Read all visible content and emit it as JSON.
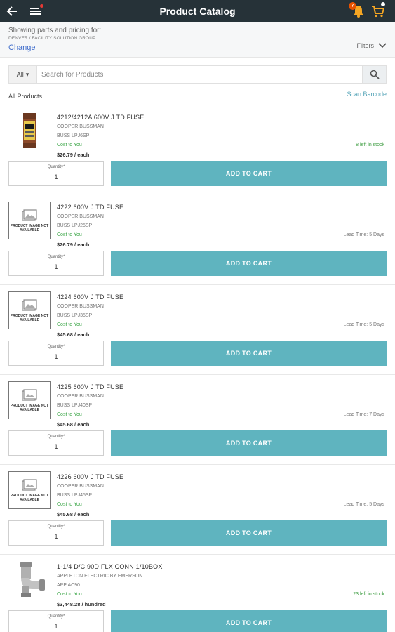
{
  "header": {
    "title": "Product Catalog",
    "notification_count": "7"
  },
  "location": {
    "line1": "Showing parts and pricing for:",
    "line2": "DENVER / FACILITY SOLUTION GROUP",
    "change_label": "Change",
    "filters_label": "Filters"
  },
  "search": {
    "category": "All",
    "placeholder": "Search for Products"
  },
  "list": {
    "heading": "All Products",
    "scan_label": "Scan Barcode"
  },
  "not_available_text": "PRODUCT IMAGE NOT AVAILABLE",
  "products": [
    {
      "name": "4212/4212A 600V J TD FUSE",
      "manufacturer": "COOPER BUSSMAN",
      "part": "BUSS LPJ6SP",
      "cost_label": "Cost to You",
      "price": "$26.79 / each",
      "availability": "8 left in stock",
      "qty_label": "Quantity*",
      "qty": "1",
      "button": "ADD TO CART"
    },
    {
      "name": "4222 600V J TD FUSE",
      "manufacturer": "COOPER BUSSMAN",
      "part": "BUSS LPJ25SP",
      "cost_label": "Cost to You",
      "price": "$26.79 / each",
      "availability": "Lead Time: 5 Days",
      "qty_label": "Quantity*",
      "qty": "1",
      "button": "ADD TO CART"
    },
    {
      "name": "4224 600V J TD FUSE",
      "manufacturer": "COOPER BUSSMAN",
      "part": "BUSS LPJ35SP",
      "cost_label": "Cost to You",
      "price": "$45.68 / each",
      "availability": "Lead Time: 5 Days",
      "qty_label": "Quantity*",
      "qty": "1",
      "button": "ADD TO CART"
    },
    {
      "name": "4225 600V J TD FUSE",
      "manufacturer": "COOPER BUSSMAN",
      "part": "BUSS LPJ40SP",
      "cost_label": "Cost to You",
      "price": "$45.68 / each",
      "availability": "Lead Time: 7 Days",
      "qty_label": "Quantity*",
      "qty": "1",
      "button": "ADD TO CART"
    },
    {
      "name": "4226 600V J TD FUSE",
      "manufacturer": "COOPER BUSSMAN",
      "part": "BUSS LPJ45SP",
      "cost_label": "Cost to You",
      "price": "$45.68 / each",
      "availability": "Lead Time: 5 Days",
      "qty_label": "Quantity*",
      "qty": "1",
      "button": "ADD TO CART"
    },
    {
      "name": "1-1/4 D/C 90D FLX CONN 1/10BOX",
      "manufacturer": "APPLETON ELECTRIC BY EMERSON",
      "part": "APP AC90",
      "cost_label": "Cost to You",
      "price": "$3,448.28 / hundred",
      "availability": "23 left in stock",
      "qty_label": "Quantity*",
      "qty": "1",
      "button": "ADD TO CART"
    }
  ],
  "colors": {
    "topbar": "#263238",
    "accent_button": "#5fb4bf",
    "in_stock": "#43a047",
    "link": "#3f6ccb"
  }
}
